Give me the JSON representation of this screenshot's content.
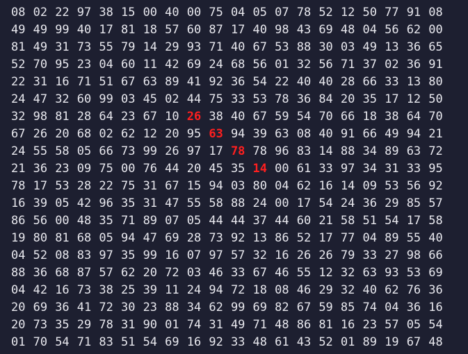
{
  "grid": {
    "rows": [
      [
        "08",
        "02",
        "22",
        "97",
        "38",
        "15",
        "00",
        "40",
        "00",
        "75",
        "04",
        "05",
        "07",
        "78",
        "52",
        "12",
        "50",
        "77",
        "91",
        "08"
      ],
      [
        "49",
        "49",
        "99",
        "40",
        "17",
        "81",
        "18",
        "57",
        "60",
        "87",
        "17",
        "40",
        "98",
        "43",
        "69",
        "48",
        "04",
        "56",
        "62",
        "00"
      ],
      [
        "81",
        "49",
        "31",
        "73",
        "55",
        "79",
        "14",
        "29",
        "93",
        "71",
        "40",
        "67",
        "53",
        "88",
        "30",
        "03",
        "49",
        "13",
        "36",
        "65"
      ],
      [
        "52",
        "70",
        "95",
        "23",
        "04",
        "60",
        "11",
        "42",
        "69",
        "24",
        "68",
        "56",
        "01",
        "32",
        "56",
        "71",
        "37",
        "02",
        "36",
        "91"
      ],
      [
        "22",
        "31",
        "16",
        "71",
        "51",
        "67",
        "63",
        "89",
        "41",
        "92",
        "36",
        "54",
        "22",
        "40",
        "40",
        "28",
        "66",
        "33",
        "13",
        "80"
      ],
      [
        "24",
        "47",
        "32",
        "60",
        "99",
        "03",
        "45",
        "02",
        "44",
        "75",
        "33",
        "53",
        "78",
        "36",
        "84",
        "20",
        "35",
        "17",
        "12",
        "50"
      ],
      [
        "32",
        "98",
        "81",
        "28",
        "64",
        "23",
        "67",
        "10",
        "26",
        "38",
        "40",
        "67",
        "59",
        "54",
        "70",
        "66",
        "18",
        "38",
        "64",
        "70"
      ],
      [
        "67",
        "26",
        "20",
        "68",
        "02",
        "62",
        "12",
        "20",
        "95",
        "63",
        "94",
        "39",
        "63",
        "08",
        "40",
        "91",
        "66",
        "49",
        "94",
        "21"
      ],
      [
        "24",
        "55",
        "58",
        "05",
        "66",
        "73",
        "99",
        "26",
        "97",
        "17",
        "78",
        "78",
        "96",
        "83",
        "14",
        "88",
        "34",
        "89",
        "63",
        "72"
      ],
      [
        "21",
        "36",
        "23",
        "09",
        "75",
        "00",
        "76",
        "44",
        "20",
        "45",
        "35",
        "14",
        "00",
        "61",
        "33",
        "97",
        "34",
        "31",
        "33",
        "95"
      ],
      [
        "78",
        "17",
        "53",
        "28",
        "22",
        "75",
        "31",
        "67",
        "15",
        "94",
        "03",
        "80",
        "04",
        "62",
        "16",
        "14",
        "09",
        "53",
        "56",
        "92"
      ],
      [
        "16",
        "39",
        "05",
        "42",
        "96",
        "35",
        "31",
        "47",
        "55",
        "58",
        "88",
        "24",
        "00",
        "17",
        "54",
        "24",
        "36",
        "29",
        "85",
        "57"
      ],
      [
        "86",
        "56",
        "00",
        "48",
        "35",
        "71",
        "89",
        "07",
        "05",
        "44",
        "44",
        "37",
        "44",
        "60",
        "21",
        "58",
        "51",
        "54",
        "17",
        "58"
      ],
      [
        "19",
        "80",
        "81",
        "68",
        "05",
        "94",
        "47",
        "69",
        "28",
        "73",
        "92",
        "13",
        "86",
        "52",
        "17",
        "77",
        "04",
        "89",
        "55",
        "40"
      ],
      [
        "04",
        "52",
        "08",
        "83",
        "97",
        "35",
        "99",
        "16",
        "07",
        "97",
        "57",
        "32",
        "16",
        "26",
        "26",
        "79",
        "33",
        "27",
        "98",
        "66"
      ],
      [
        "88",
        "36",
        "68",
        "87",
        "57",
        "62",
        "20",
        "72",
        "03",
        "46",
        "33",
        "67",
        "46",
        "55",
        "12",
        "32",
        "63",
        "93",
        "53",
        "69"
      ],
      [
        "04",
        "42",
        "16",
        "73",
        "38",
        "25",
        "39",
        "11",
        "24",
        "94",
        "72",
        "18",
        "08",
        "46",
        "29",
        "32",
        "40",
        "62",
        "76",
        "36"
      ],
      [
        "20",
        "69",
        "36",
        "41",
        "72",
        "30",
        "23",
        "88",
        "34",
        "62",
        "99",
        "69",
        "82",
        "67",
        "59",
        "85",
        "74",
        "04",
        "36",
        "16"
      ],
      [
        "20",
        "73",
        "35",
        "29",
        "78",
        "31",
        "90",
        "01",
        "74",
        "31",
        "49",
        "71",
        "48",
        "86",
        "81",
        "16",
        "23",
        "57",
        "05",
        "54"
      ],
      [
        "01",
        "70",
        "54",
        "71",
        "83",
        "51",
        "54",
        "69",
        "16",
        "92",
        "33",
        "48",
        "61",
        "43",
        "52",
        "01",
        "89",
        "19",
        "67",
        "48"
      ]
    ],
    "highlighted": [
      {
        "row": 6,
        "col": 8
      },
      {
        "row": 7,
        "col": 9
      },
      {
        "row": 8,
        "col": 10
      },
      {
        "row": 9,
        "col": 11
      }
    ],
    "colors": {
      "background": "#1d1f30",
      "text": "#e8e8ee",
      "highlight": "#ff1f1f"
    }
  }
}
